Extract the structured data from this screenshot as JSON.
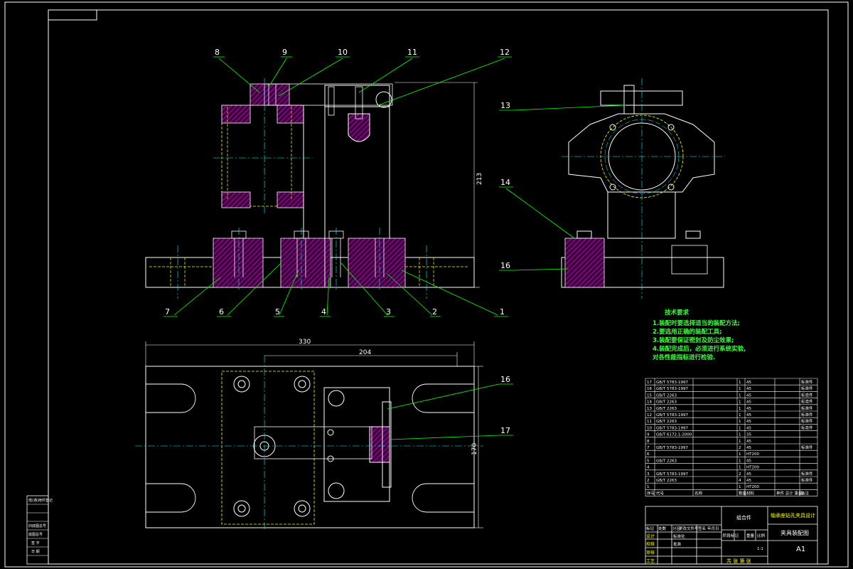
{
  "drawing": {
    "callouts_front": [
      "8",
      "9",
      "10",
      "11",
      "12"
    ],
    "callouts_front_bottom": [
      "7",
      "6",
      "5",
      "4",
      "3",
      "2",
      "1"
    ],
    "callouts_side": [
      "13",
      "14",
      "16"
    ],
    "callouts_plan": [
      "16",
      "17"
    ],
    "dim_height": "213",
    "dim_width_total": "330",
    "dim_width_inner": "204",
    "dim_plan_height": "170"
  },
  "tech_requirements": {
    "title": "技术要求",
    "lines": [
      "1.装配时要选择适当的装配方法;",
      "2.要选用正确的装配工具;",
      "3.装配要保证密封及防尘效果;",
      "4.装配完成后，必须进行系统实验,",
      "  对各性能指标进行检验."
    ]
  },
  "bom_rows": [
    [
      "17",
      "GB/T 5783-1997",
      "",
      "1",
      "45",
      "",
      "标准件"
    ],
    [
      "16",
      "GB/T 5783-1997",
      "",
      "1",
      "45",
      "",
      "标准件"
    ],
    [
      "15",
      "GB/T 2263",
      "",
      "1",
      "45",
      "",
      "标准件"
    ],
    [
      "14",
      "GB/T 2263",
      "",
      "1",
      "45",
      "",
      "标准件"
    ],
    [
      "13",
      "GB/T 2263",
      "",
      "1",
      "45",
      "",
      "标准件"
    ],
    [
      "12",
      "GB/T 5783-1997",
      "",
      "1",
      "45",
      "",
      "标准件"
    ],
    [
      "11",
      "GB/T 2263",
      "",
      "1",
      "45",
      "",
      "标准件"
    ],
    [
      "10",
      "GB/T 5783-1997",
      "",
      "1",
      "45",
      "",
      "标准件"
    ],
    [
      "9",
      "GB/T 6172.1-2000",
      "",
      "1",
      "35",
      "",
      ""
    ],
    [
      "8",
      "",
      "",
      "1",
      "45",
      "",
      ""
    ],
    [
      "7",
      "GB/T 5783-1997",
      "",
      "2",
      "45",
      "",
      "标准件"
    ],
    [
      "6",
      "",
      "",
      "1",
      "HT200",
      "",
      ""
    ],
    [
      "5",
      "GB/T 2263",
      "",
      "1",
      "45",
      "",
      ""
    ],
    [
      "4",
      "",
      "",
      "1",
      "HT200",
      "",
      ""
    ],
    [
      "3",
      "GB/T 5783-1997",
      "",
      "2",
      "45",
      "",
      "标准件"
    ],
    [
      "2",
      "GB/T 2263",
      "",
      "4",
      "45",
      "",
      "标准件"
    ],
    [
      "1",
      "",
      "",
      "1",
      "HT200",
      "",
      ""
    ]
  ],
  "bom_header": [
    "序号",
    "代号",
    "名称",
    "数量",
    "材料",
    "单件 总计 重量",
    "备注"
  ],
  "title_block": {
    "company": "组合件",
    "project": "轴承座钻孔夹具设计",
    "drawing_name": "夹具装配图",
    "size": "A1",
    "stage_labels": [
      "阶段标记",
      "重量",
      "比例"
    ],
    "scale": "1:1",
    "sheet": "共 张  第 张",
    "rows": [
      "标记",
      "处数",
      "分区",
      "更改文件号",
      "签名",
      "年月日"
    ],
    "roles": [
      "设计",
      "校核",
      "审核",
      "工艺"
    ],
    "roles_right": [
      "标准化",
      "批准"
    ]
  },
  "side_block": [
    "借(通)用件登记",
    "",
    "旧底图总号",
    "底图总号",
    "签 字",
    "日 期"
  ],
  "colors": {
    "background": "#000000",
    "outline": "#ffffff",
    "hatch": "#c000c0",
    "hidden": "#ffff00",
    "center": "#00ffff",
    "leader": "#00ff00",
    "text_green": "#3cff3c"
  }
}
